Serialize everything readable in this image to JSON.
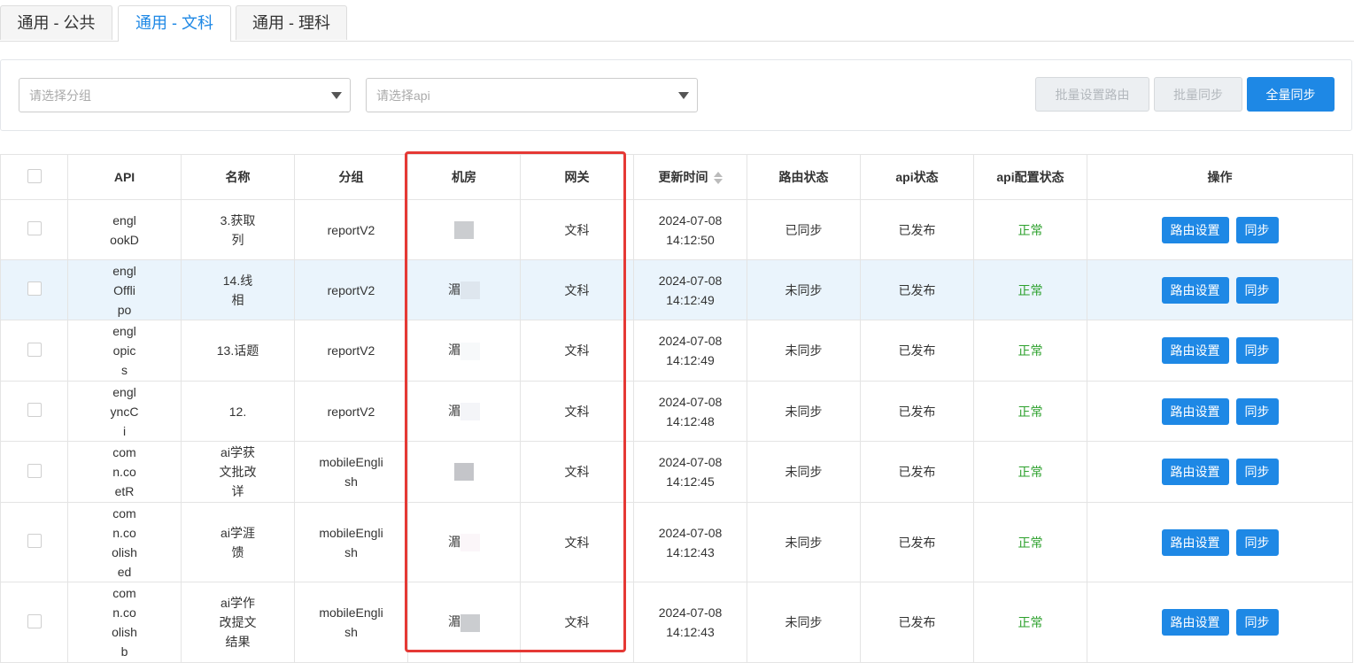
{
  "tabs": [
    {
      "label": "通用 - 公共",
      "active": false
    },
    {
      "label": "通用 - 文科",
      "active": true
    },
    {
      "label": "通用 - 理科",
      "active": false
    }
  ],
  "filters": {
    "group_placeholder": "请选择分组",
    "api_placeholder": "请选择api"
  },
  "actions": {
    "batch_route": "批量设置路由",
    "batch_sync": "批量同步",
    "full_sync": "全量同步"
  },
  "table": {
    "headers": {
      "api": "API",
      "name": "名称",
      "group": "分组",
      "room": "机房",
      "gateway": "网关",
      "updated": "更新时间",
      "route_status": "路由状态",
      "api_status": "api状态",
      "api_config_status": "api配置状态",
      "ops": "操作"
    },
    "rows": [
      {
        "api": [
          "engl",
          "ookD"
        ],
        "name": [
          "3.获取",
          "列"
        ],
        "group": [
          "reportV2"
        ],
        "room": "",
        "gateway": "文科",
        "date": "2024-07-08",
        "time": "14:12:50",
        "route_status": "已同步",
        "api_status": "已发布",
        "config_status": "正常",
        "highlight": false
      },
      {
        "api": [
          "engl",
          "Offli",
          "po"
        ],
        "name": [
          "14.线",
          "相"
        ],
        "group": [
          "reportV2"
        ],
        "room": "湄",
        "gateway": "文科",
        "date": "2024-07-08",
        "time": "14:12:49",
        "route_status": "未同步",
        "api_status": "已发布",
        "config_status": "正常",
        "highlight": true
      },
      {
        "api": [
          "engl",
          "opic",
          "s"
        ],
        "name": [
          "13.话题"
        ],
        "group": [
          "reportV2"
        ],
        "room": "湄",
        "gateway": "文科",
        "date": "2024-07-08",
        "time": "14:12:49",
        "route_status": "未同步",
        "api_status": "已发布",
        "config_status": "正常",
        "highlight": false
      },
      {
        "api": [
          "engl",
          "yncC",
          "i"
        ],
        "name": [
          "12."
        ],
        "group": [
          "reportV2"
        ],
        "room": "湄",
        "gateway": "文科",
        "date": "2024-07-08",
        "time": "14:12:48",
        "route_status": "未同步",
        "api_status": "已发布",
        "config_status": "正常",
        "highlight": false
      },
      {
        "api": [
          "com",
          "n.co",
          "etR"
        ],
        "name": [
          "ai学获",
          "文批改",
          "详"
        ],
        "group": [
          "mobileEngli",
          "sh"
        ],
        "room": "",
        "gateway": "文科",
        "date": "2024-07-08",
        "time": "14:12:45",
        "route_status": "未同步",
        "api_status": "已发布",
        "config_status": "正常",
        "highlight": false
      },
      {
        "api": [
          "com",
          "n.co",
          "olish",
          "ed"
        ],
        "name": [
          "ai学涯",
          "馈"
        ],
        "group": [
          "mobileEngli",
          "sh"
        ],
        "room": "湄",
        "gateway": "文科",
        "date": "2024-07-08",
        "time": "14:12:43",
        "route_status": "未同步",
        "api_status": "已发布",
        "config_status": "正常",
        "highlight": false
      },
      {
        "api": [
          "com",
          "n.co",
          "olish",
          "b"
        ],
        "name": [
          "ai学作",
          "改提文",
          "结果"
        ],
        "group": [
          "mobileEngli",
          "sh"
        ],
        "room": "湄",
        "gateway": "文科",
        "date": "2024-07-08",
        "time": "14:12:43",
        "route_status": "未同步",
        "api_status": "已发布",
        "config_status": "正常",
        "highlight": false
      }
    ],
    "op_route_label": "路由设置",
    "op_sync_label": "同步"
  },
  "colors": {
    "primary": "#1e88e5",
    "ok_green": "#2ca02c",
    "highlight_row": "#eaf4fc",
    "annotation_red": "#e53935"
  }
}
